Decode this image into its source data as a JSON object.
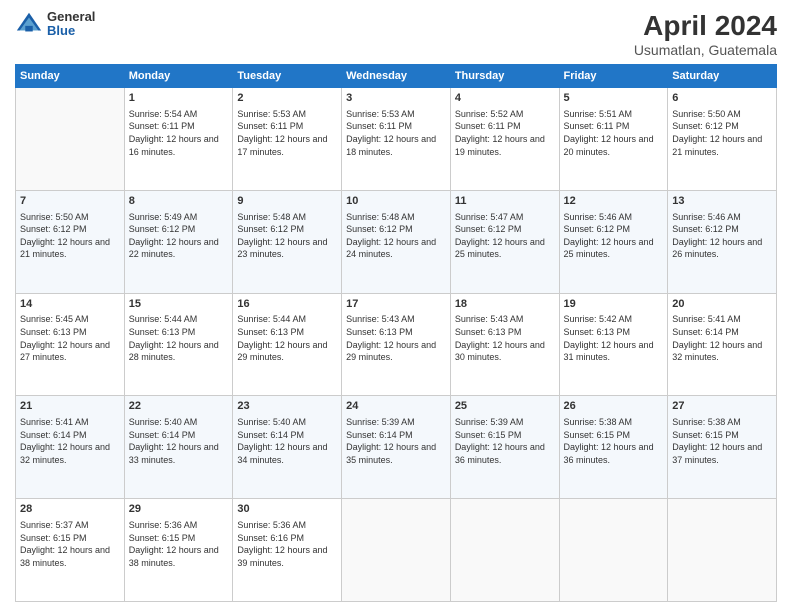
{
  "header": {
    "logo": {
      "general": "General",
      "blue": "Blue"
    },
    "title": "April 2024",
    "subtitle": "Usumatlan, Guatemala"
  },
  "calendar": {
    "headers": [
      "Sunday",
      "Monday",
      "Tuesday",
      "Wednesday",
      "Thursday",
      "Friday",
      "Saturday"
    ],
    "rows": [
      [
        {
          "day": "",
          "sunrise": "",
          "sunset": "",
          "daylight": "",
          "empty": true
        },
        {
          "day": "1",
          "sunrise": "Sunrise: 5:54 AM",
          "sunset": "Sunset: 6:11 PM",
          "daylight": "Daylight: 12 hours and 16 minutes."
        },
        {
          "day": "2",
          "sunrise": "Sunrise: 5:53 AM",
          "sunset": "Sunset: 6:11 PM",
          "daylight": "Daylight: 12 hours and 17 minutes."
        },
        {
          "day": "3",
          "sunrise": "Sunrise: 5:53 AM",
          "sunset": "Sunset: 6:11 PM",
          "daylight": "Daylight: 12 hours and 18 minutes."
        },
        {
          "day": "4",
          "sunrise": "Sunrise: 5:52 AM",
          "sunset": "Sunset: 6:11 PM",
          "daylight": "Daylight: 12 hours and 19 minutes."
        },
        {
          "day": "5",
          "sunrise": "Sunrise: 5:51 AM",
          "sunset": "Sunset: 6:11 PM",
          "daylight": "Daylight: 12 hours and 20 minutes."
        },
        {
          "day": "6",
          "sunrise": "Sunrise: 5:50 AM",
          "sunset": "Sunset: 6:12 PM",
          "daylight": "Daylight: 12 hours and 21 minutes."
        }
      ],
      [
        {
          "day": "7",
          "sunrise": "Sunrise: 5:50 AM",
          "sunset": "Sunset: 6:12 PM",
          "daylight": "Daylight: 12 hours and 21 minutes."
        },
        {
          "day": "8",
          "sunrise": "Sunrise: 5:49 AM",
          "sunset": "Sunset: 6:12 PM",
          "daylight": "Daylight: 12 hours and 22 minutes."
        },
        {
          "day": "9",
          "sunrise": "Sunrise: 5:48 AM",
          "sunset": "Sunset: 6:12 PM",
          "daylight": "Daylight: 12 hours and 23 minutes."
        },
        {
          "day": "10",
          "sunrise": "Sunrise: 5:48 AM",
          "sunset": "Sunset: 6:12 PM",
          "daylight": "Daylight: 12 hours and 24 minutes."
        },
        {
          "day": "11",
          "sunrise": "Sunrise: 5:47 AM",
          "sunset": "Sunset: 6:12 PM",
          "daylight": "Daylight: 12 hours and 25 minutes."
        },
        {
          "day": "12",
          "sunrise": "Sunrise: 5:46 AM",
          "sunset": "Sunset: 6:12 PM",
          "daylight": "Daylight: 12 hours and 25 minutes."
        },
        {
          "day": "13",
          "sunrise": "Sunrise: 5:46 AM",
          "sunset": "Sunset: 6:12 PM",
          "daylight": "Daylight: 12 hours and 26 minutes."
        }
      ],
      [
        {
          "day": "14",
          "sunrise": "Sunrise: 5:45 AM",
          "sunset": "Sunset: 6:13 PM",
          "daylight": "Daylight: 12 hours and 27 minutes."
        },
        {
          "day": "15",
          "sunrise": "Sunrise: 5:44 AM",
          "sunset": "Sunset: 6:13 PM",
          "daylight": "Daylight: 12 hours and 28 minutes."
        },
        {
          "day": "16",
          "sunrise": "Sunrise: 5:44 AM",
          "sunset": "Sunset: 6:13 PM",
          "daylight": "Daylight: 12 hours and 29 minutes."
        },
        {
          "day": "17",
          "sunrise": "Sunrise: 5:43 AM",
          "sunset": "Sunset: 6:13 PM",
          "daylight": "Daylight: 12 hours and 29 minutes."
        },
        {
          "day": "18",
          "sunrise": "Sunrise: 5:43 AM",
          "sunset": "Sunset: 6:13 PM",
          "daylight": "Daylight: 12 hours and 30 minutes."
        },
        {
          "day": "19",
          "sunrise": "Sunrise: 5:42 AM",
          "sunset": "Sunset: 6:13 PM",
          "daylight": "Daylight: 12 hours and 31 minutes."
        },
        {
          "day": "20",
          "sunrise": "Sunrise: 5:41 AM",
          "sunset": "Sunset: 6:14 PM",
          "daylight": "Daylight: 12 hours and 32 minutes."
        }
      ],
      [
        {
          "day": "21",
          "sunrise": "Sunrise: 5:41 AM",
          "sunset": "Sunset: 6:14 PM",
          "daylight": "Daylight: 12 hours and 32 minutes."
        },
        {
          "day": "22",
          "sunrise": "Sunrise: 5:40 AM",
          "sunset": "Sunset: 6:14 PM",
          "daylight": "Daylight: 12 hours and 33 minutes."
        },
        {
          "day": "23",
          "sunrise": "Sunrise: 5:40 AM",
          "sunset": "Sunset: 6:14 PM",
          "daylight": "Daylight: 12 hours and 34 minutes."
        },
        {
          "day": "24",
          "sunrise": "Sunrise: 5:39 AM",
          "sunset": "Sunset: 6:14 PM",
          "daylight": "Daylight: 12 hours and 35 minutes."
        },
        {
          "day": "25",
          "sunrise": "Sunrise: 5:39 AM",
          "sunset": "Sunset: 6:15 PM",
          "daylight": "Daylight: 12 hours and 36 minutes."
        },
        {
          "day": "26",
          "sunrise": "Sunrise: 5:38 AM",
          "sunset": "Sunset: 6:15 PM",
          "daylight": "Daylight: 12 hours and 36 minutes."
        },
        {
          "day": "27",
          "sunrise": "Sunrise: 5:38 AM",
          "sunset": "Sunset: 6:15 PM",
          "daylight": "Daylight: 12 hours and 37 minutes."
        }
      ],
      [
        {
          "day": "28",
          "sunrise": "Sunrise: 5:37 AM",
          "sunset": "Sunset: 6:15 PM",
          "daylight": "Daylight: 12 hours and 38 minutes."
        },
        {
          "day": "29",
          "sunrise": "Sunrise: 5:36 AM",
          "sunset": "Sunset: 6:15 PM",
          "daylight": "Daylight: 12 hours and 38 minutes."
        },
        {
          "day": "30",
          "sunrise": "Sunrise: 5:36 AM",
          "sunset": "Sunset: 6:16 PM",
          "daylight": "Daylight: 12 hours and 39 minutes."
        },
        {
          "day": "",
          "sunrise": "",
          "sunset": "",
          "daylight": "",
          "empty": true
        },
        {
          "day": "",
          "sunrise": "",
          "sunset": "",
          "daylight": "",
          "empty": true
        },
        {
          "day": "",
          "sunrise": "",
          "sunset": "",
          "daylight": "",
          "empty": true
        },
        {
          "day": "",
          "sunrise": "",
          "sunset": "",
          "daylight": "",
          "empty": true
        }
      ]
    ]
  }
}
